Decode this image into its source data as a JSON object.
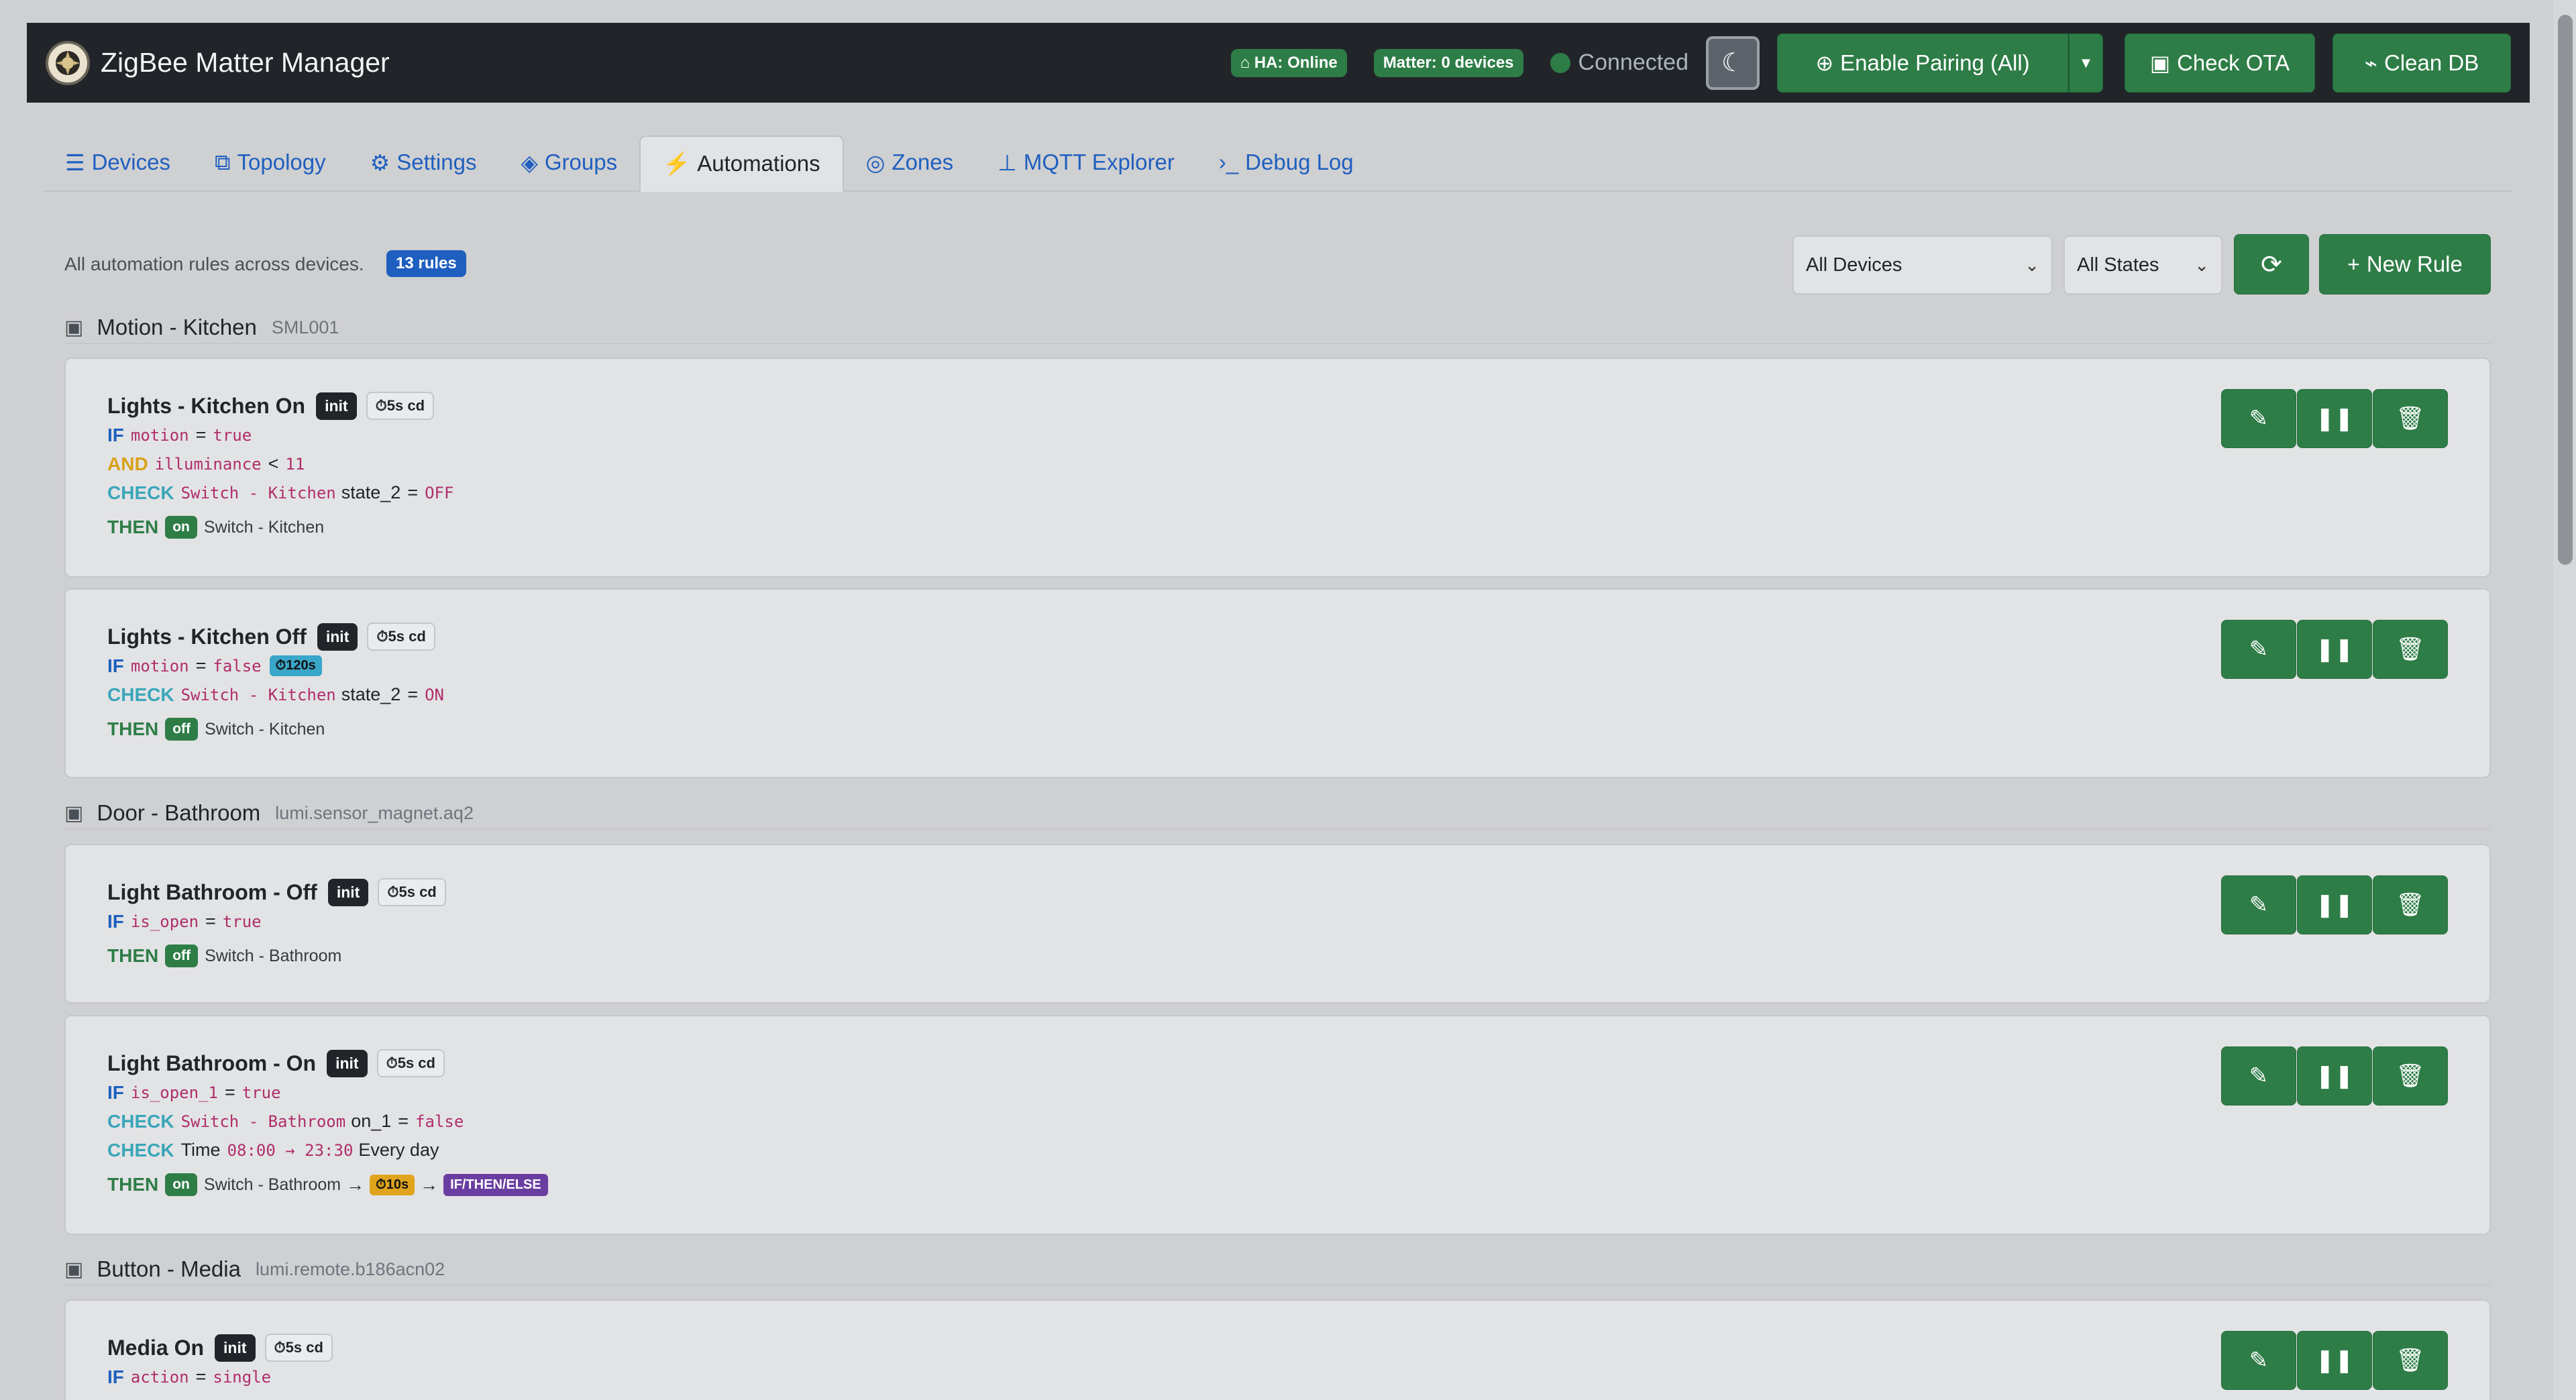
{
  "header": {
    "title": "ZigBee Matter Manager",
    "ha_status": "HA: Online",
    "matter_status": "Matter: 0 devices",
    "connection": "Connected",
    "pairing_label": "Enable Pairing (All)",
    "ota_label": "Check OTA",
    "clean_label": "Clean DB"
  },
  "tabs": [
    {
      "label": "Devices",
      "icon": "list-icon"
    },
    {
      "label": "Topology",
      "icon": "topology-icon"
    },
    {
      "label": "Settings",
      "icon": "gear-icon"
    },
    {
      "label": "Groups",
      "icon": "layers-icon"
    },
    {
      "label": "Automations",
      "icon": "bolt-icon",
      "active": true
    },
    {
      "label": "Zones",
      "icon": "target-icon"
    },
    {
      "label": "MQTT Explorer",
      "icon": "broadcast-icon"
    },
    {
      "label": "Debug Log",
      "icon": "terminal-icon"
    }
  ],
  "toolbar": {
    "description": "All automation rules across devices.",
    "rule_count": "13 rules",
    "device_filter": "All Devices",
    "state_filter": "All States",
    "new_rule_label": "New Rule"
  },
  "groups": [
    {
      "name": "Motion - Kitchen",
      "model": "SML001",
      "rules": [
        {
          "name": "Lights - Kitchen On",
          "init": "init",
          "cooldown": "⏱5s cd",
          "conditions": [
            {
              "kw": "IF",
              "attr": "motion",
              "op": "=",
              "val": "true"
            },
            {
              "kw": "AND",
              "attr": "illuminance",
              "op": "<",
              "val": "11"
            },
            {
              "kw": "CHECK",
              "device": "Switch - Kitchen",
              "attr": "state_2",
              "op": "=",
              "val": "OFF"
            }
          ],
          "then": {
            "kw": "THEN",
            "action": "on",
            "target": "Switch - Kitchen"
          }
        },
        {
          "name": "Lights - Kitchen Off",
          "init": "init",
          "cooldown": "⏱5s cd",
          "conditions": [
            {
              "kw": "IF",
              "attr": "motion",
              "op": "=",
              "val": "false",
              "delay": "⏱120s"
            },
            {
              "kw": "CHECK",
              "device": "Switch - Kitchen",
              "attr": "state_2",
              "op": "=",
              "val": "ON"
            }
          ],
          "then": {
            "kw": "THEN",
            "action": "off",
            "target": "Switch - Kitchen"
          }
        }
      ]
    },
    {
      "name": "Door - Bathroom",
      "model": "lumi.sensor_magnet.aq2",
      "rules": [
        {
          "name": "Light Bathroom - Off",
          "init": "init",
          "cooldown": "⏱5s cd",
          "conditions": [
            {
              "kw": "IF",
              "attr": "is_open",
              "op": "=",
              "val": "true"
            }
          ],
          "then": {
            "kw": "THEN",
            "action": "off",
            "target": "Switch - Bathroom"
          }
        },
        {
          "name": "Light Bathroom - On",
          "init": "init",
          "cooldown": "⏱5s cd",
          "conditions": [
            {
              "kw": "IF",
              "attr": "is_open_1",
              "op": "=",
              "val": "true"
            },
            {
              "kw": "CHECK",
              "device": "Switch - Bathroom",
              "attr": "on_1",
              "op": "=",
              "val": "false"
            },
            {
              "kw": "CHECK",
              "label": "Time",
              "range": "08:00 → 23:30",
              "days": "Every day"
            }
          ],
          "then": {
            "kw": "THEN",
            "action": "on",
            "target": "Switch - Bathroom",
            "arrow": "→",
            "delay": "⏱10s",
            "next": "IF/THEN/ELSE"
          }
        }
      ]
    },
    {
      "name": "Button - Media",
      "model": "lumi.remote.b186acn02",
      "rules": [
        {
          "name": "Media On",
          "init": "init",
          "cooldown": "⏱5s cd",
          "conditions": [
            {
              "kw": "IF",
              "attr": "action",
              "op": "=",
              "val": "single"
            }
          ]
        }
      ]
    }
  ]
}
